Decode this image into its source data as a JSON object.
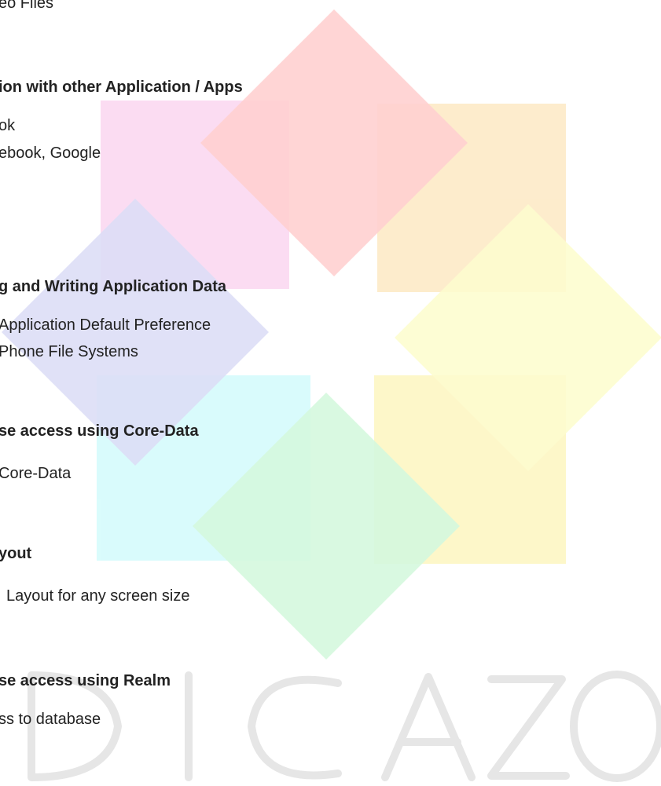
{
  "watermark": {
    "label": "DICAZO",
    "colors": {
      "pink": "#fbd7f0",
      "red": "#ffc9c9",
      "orange": "#fde9c4",
      "yellow": "#fdfcc7",
      "lavender": "#d7d8f5",
      "cyan": "#d3fbfc",
      "mint": "#cdf7d8",
      "gold": "#fdf6c0",
      "letters": "#e6e6e6"
    }
  },
  "lines": [
    {
      "text": "eo Files",
      "type": "item"
    },
    {
      "text": "ion with other Application / Apps",
      "type": "heading"
    },
    {
      "text": "ok",
      "type": "item"
    },
    {
      "text": "ebook, Google",
      "type": "item"
    },
    {
      "text": "g and Writing Application Data",
      "type": "heading"
    },
    {
      "text": "Application Default Preference",
      "type": "item"
    },
    {
      "text": "Phone File Systems",
      "type": "item"
    },
    {
      "text": "se access using Core-Data",
      "type": "heading"
    },
    {
      "text": "Core-Data",
      "type": "item"
    },
    {
      "text": "yout",
      "type": "heading"
    },
    {
      "text": "Layout for any screen size",
      "type": "item"
    },
    {
      "text": "se access using Realm",
      "type": "heading"
    },
    {
      "text": "ss to database",
      "type": "item"
    }
  ]
}
